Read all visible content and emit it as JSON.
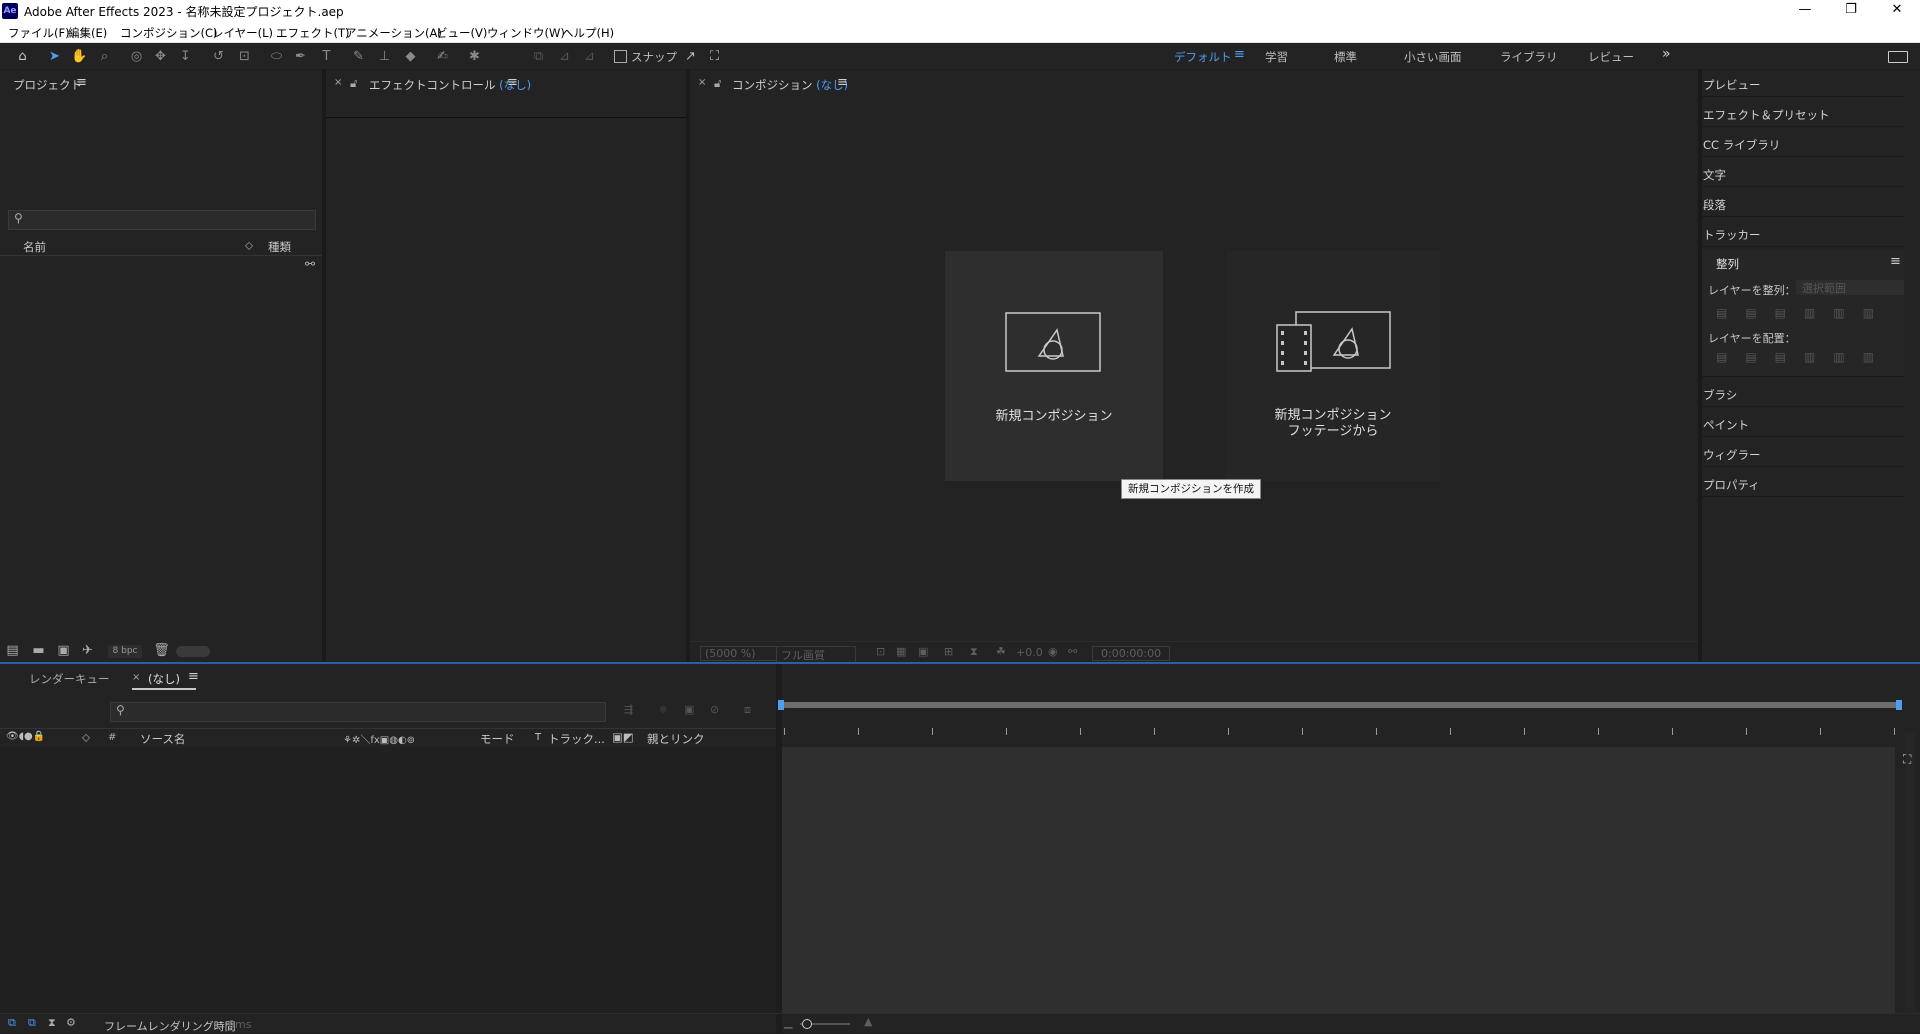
{
  "window": {
    "app_icon_label": "Ae",
    "title": "Adobe After Effects 2023 - 名称未設定プロジェクト.aep",
    "minimize": "—",
    "maximize": "❐",
    "close": "✕"
  },
  "menu": [
    "ファイル(F)",
    "編集(E)",
    "コンポジション(C)",
    "レイヤー(L)",
    "エフェクト(T)",
    "アニメーション(A)",
    "ビュー(V)",
    "ウィンドウ(W)",
    "ヘルプ(H)"
  ],
  "toolbar": {
    "snap_label": "スナップ",
    "workspaces": [
      "デフォルト",
      "学習",
      "標準",
      "小さい画面",
      "ライブラリ",
      "レビュー"
    ],
    "active_workspace": "デフォルト",
    "more": "»"
  },
  "project_panel": {
    "title": "プロジェクト",
    "search_placeholder": "",
    "col_name": "名前",
    "col_type": "種類",
    "bpc": "8 bpc"
  },
  "effect_panel": {
    "title": "エフェクトコントロール",
    "title_suffix": "(なし)"
  },
  "comp_panel": {
    "title": "コンポジション",
    "title_suffix": "(なし)",
    "tile1_label": "新規コンポジション",
    "tile2_line1": "新規コンポジション",
    "tile2_line2": "フッテージから",
    "tooltip": "新規コンポジションを作成",
    "zoom": "(5000 %)",
    "resolution": "フル画質",
    "exposure": "+0.0",
    "timecode": "0:00:00:00"
  },
  "right_panel": {
    "items_top": [
      "プレビュー",
      "エフェクト＆プリセット",
      "CC ライブラリ",
      "文字",
      "段落",
      "トラッカー"
    ],
    "align_title": "整列",
    "align_layers_label": "レイヤーを整列：",
    "align_to_value": "選択範囲",
    "distribute_label": "レイヤーを配置：",
    "items_bottom": [
      "ブラシ",
      "ペイント",
      "ウィグラー",
      "プロパティ"
    ]
  },
  "timeline": {
    "tab_render": "レンダーキュー",
    "tab_none": "(なし)",
    "search_placeholder": "",
    "col_source": "ソース名",
    "col_mode": "モード",
    "col_t": "T",
    "col_track": "トラック...",
    "col_parent": "親とリンク",
    "footer_label": "フレームレンダリング時間",
    "footer_value": "0ms"
  }
}
